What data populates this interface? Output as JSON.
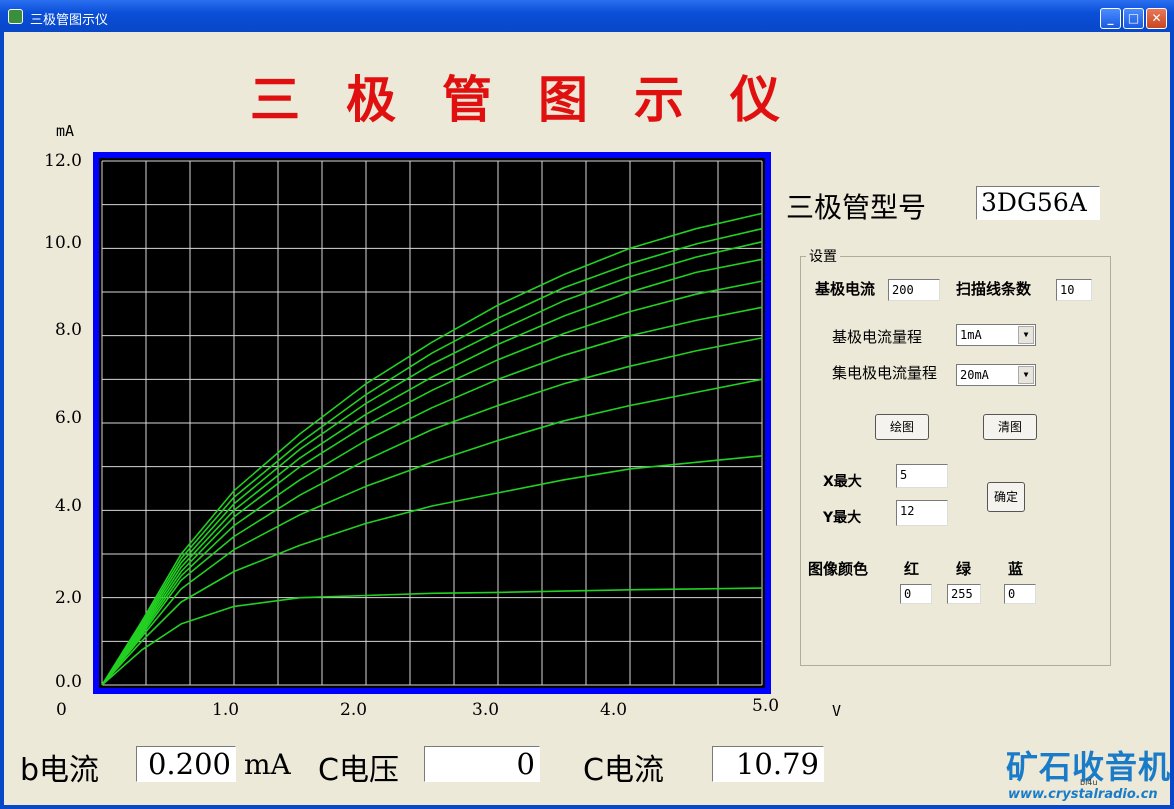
{
  "window": {
    "title": "三极管图示仪",
    "min_label": "_",
    "max_label": "□",
    "close_label": "✕"
  },
  "app": {
    "heading": "三极管图示仪"
  },
  "chart_data": {
    "type": "line",
    "title": "",
    "xlabel": "V",
    "ylabel": "mA",
    "x_ticks": [
      "0",
      "1.0",
      "2.0",
      "3.0",
      "4.0",
      "5.0"
    ],
    "y_ticks": [
      "0.0",
      "2.0",
      "4.0",
      "6.0",
      "8.0",
      "10.0",
      "12.0"
    ],
    "xlim": [
      0,
      5
    ],
    "ylim": [
      0,
      12
    ],
    "grid": true,
    "background": "#000000",
    "border_color": "#0000ff",
    "series_color": "#22d022",
    "series": [
      {
        "x": [
          0,
          0.3,
          0.6,
          1.0,
          1.5,
          2.0,
          2.5,
          3.0,
          3.5,
          4.0,
          4.5,
          5.0
        ],
        "values": [
          0,
          0.8,
          1.4,
          1.8,
          2.0,
          2.05,
          2.1,
          2.12,
          2.15,
          2.18,
          2.2,
          2.22
        ]
      },
      {
        "x": [
          0,
          0.3,
          0.6,
          1.0,
          1.5,
          2.0,
          2.5,
          3.0,
          3.5,
          4.0,
          4.5,
          5.0
        ],
        "values": [
          0,
          1.0,
          1.9,
          2.6,
          3.2,
          3.7,
          4.1,
          4.4,
          4.7,
          4.95,
          5.1,
          5.25
        ]
      },
      {
        "x": [
          0,
          0.3,
          0.6,
          1.0,
          1.5,
          2.0,
          2.5,
          3.0,
          3.5,
          4.0,
          4.5,
          5.0
        ],
        "values": [
          0,
          1.1,
          2.2,
          3.1,
          3.9,
          4.55,
          5.1,
          5.6,
          6.05,
          6.4,
          6.7,
          7.0
        ]
      },
      {
        "x": [
          0,
          0.3,
          0.6,
          1.0,
          1.5,
          2.0,
          2.5,
          3.0,
          3.5,
          4.0,
          4.5,
          5.0
        ],
        "values": [
          0,
          1.15,
          2.4,
          3.4,
          4.35,
          5.15,
          5.85,
          6.4,
          6.9,
          7.3,
          7.65,
          7.95
        ]
      },
      {
        "x": [
          0,
          0.3,
          0.6,
          1.0,
          1.5,
          2.0,
          2.5,
          3.0,
          3.5,
          4.0,
          4.5,
          5.0
        ],
        "values": [
          0,
          1.2,
          2.5,
          3.65,
          4.7,
          5.6,
          6.35,
          7.0,
          7.55,
          8.0,
          8.35,
          8.65
        ]
      },
      {
        "x": [
          0,
          0.3,
          0.6,
          1.0,
          1.5,
          2.0,
          2.5,
          3.0,
          3.5,
          4.0,
          4.5,
          5.0
        ],
        "values": [
          0,
          1.25,
          2.6,
          3.85,
          5.0,
          5.95,
          6.75,
          7.45,
          8.05,
          8.55,
          8.95,
          9.25
        ]
      },
      {
        "x": [
          0,
          0.3,
          0.6,
          1.0,
          1.5,
          2.0,
          2.5,
          3.0,
          3.5,
          4.0,
          4.5,
          5.0
        ],
        "values": [
          0,
          1.3,
          2.7,
          4.0,
          5.2,
          6.2,
          7.05,
          7.8,
          8.45,
          9.0,
          9.45,
          9.75
        ]
      },
      {
        "x": [
          0,
          0.3,
          0.6,
          1.0,
          1.5,
          2.0,
          2.5,
          3.0,
          3.5,
          4.0,
          4.5,
          5.0
        ],
        "values": [
          0,
          1.35,
          2.8,
          4.15,
          5.4,
          6.45,
          7.35,
          8.1,
          8.8,
          9.35,
          9.8,
          10.15
        ]
      },
      {
        "x": [
          0,
          0.3,
          0.6,
          1.0,
          1.5,
          2.0,
          2.5,
          3.0,
          3.5,
          4.0,
          4.5,
          5.0
        ],
        "values": [
          0,
          1.4,
          2.9,
          4.3,
          5.55,
          6.65,
          7.6,
          8.4,
          9.1,
          9.65,
          10.1,
          10.45
        ]
      },
      {
        "x": [
          0,
          0.3,
          0.6,
          1.0,
          1.5,
          2.0,
          2.5,
          3.0,
          3.5,
          4.0,
          4.5,
          5.0
        ],
        "values": [
          0,
          1.45,
          3.0,
          4.45,
          5.75,
          6.9,
          7.85,
          8.7,
          9.4,
          10.0,
          10.45,
          10.8
        ]
      }
    ]
  },
  "model": {
    "label": "三极管型号",
    "value": "3DG56A"
  },
  "settings": {
    "group_label": "设置",
    "base_current_label": "基极电流",
    "base_current_value": "200",
    "scan_lines_label": "扫描线条数",
    "scan_lines_value": "10",
    "base_range_label": "基极电流量程",
    "base_range_value": "1mA",
    "collector_range_label": "集电极电流量程",
    "collector_range_value": "20mA",
    "draw_button": "绘图",
    "clear_button": "清图",
    "xmax_label": "X最大",
    "xmax_value": "5",
    "ymax_label": "Y最大",
    "ymax_value": "12",
    "confirm_button": "确定",
    "color_label": "图像颜色",
    "red_label": "红",
    "green_label": "绿",
    "blue_label": "蓝",
    "red_value": "0",
    "green_value": "255",
    "blue_value": "0"
  },
  "status": {
    "b_current_label": "b电流",
    "b_current_value": "0.200",
    "b_current_unit": "mA",
    "c_voltage_label": "C电压",
    "c_voltage_value": "0",
    "c_current_label": "C电流",
    "c_current_value": "10.79"
  },
  "watermark": {
    "logo": "矿石收音机",
    "url": "www.crystalradio.cn",
    "tag": "bi4u"
  }
}
